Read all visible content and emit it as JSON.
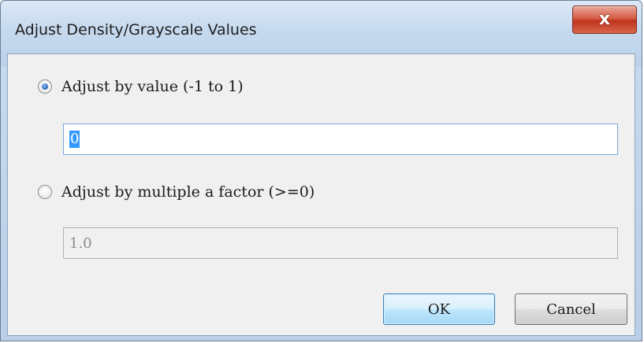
{
  "dialog": {
    "title": "Adjust Density/Grayscale Values",
    "close_glyph": "x"
  },
  "options": [
    {
      "label": "Adjust by value (-1 to 1)",
      "checked": true,
      "input_value": "0"
    },
    {
      "label": "Adjust by multiple a factor (>=0)",
      "checked": false,
      "input_value": "1.0"
    }
  ],
  "buttons": {
    "ok_label": "OK",
    "cancel_label": "Cancel"
  },
  "colors": {
    "selection": "#3399ff",
    "close_button": "#c0341d",
    "default_button_border": "#3c7fb1"
  }
}
